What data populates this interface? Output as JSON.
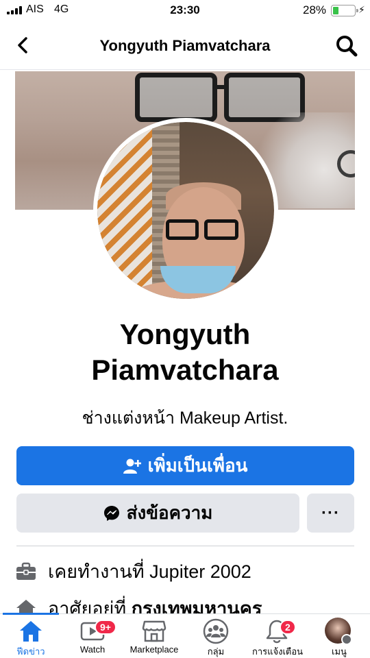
{
  "status_bar": {
    "carrier": "AIS",
    "network": "4G",
    "time": "23:30",
    "battery": "28%",
    "battery_level": 0.28
  },
  "header": {
    "title": "Yongyuth Piamvatchara",
    "back_icon": "chevron-left-icon",
    "search_icon": "search-icon"
  },
  "profile": {
    "name": "Yongyuth Piamvatchara",
    "bio": "ช่างแต่งหน้า Makeup Artist."
  },
  "actions": {
    "add_friend": "เพิ่มเป็นเพื่อน",
    "message": "ส่งข้อความ",
    "more": "···"
  },
  "info": {
    "work": "เคยทำงานที่ Jupiter 2002",
    "home_prefix": "อาศัยอยู่ที่",
    "home_city": "กรุงเทพมหานคร"
  },
  "tabs": [
    {
      "label": "ฟีดข่าว",
      "icon": "home-icon",
      "active": true
    },
    {
      "label": "Watch",
      "icon": "watch-icon",
      "badge": "9+"
    },
    {
      "label": "Marketplace",
      "icon": "marketplace-icon"
    },
    {
      "label": "กลุ่ม",
      "icon": "groups-icon"
    },
    {
      "label": "การแจ้งเตือน",
      "icon": "bell-icon",
      "badge": "2"
    },
    {
      "label": "เมนู",
      "icon": "menu-avatar-icon"
    }
  ],
  "colors": {
    "accent": "#1b74e4",
    "badge": "#f02849",
    "secondary_button": "#e4e6eb"
  }
}
